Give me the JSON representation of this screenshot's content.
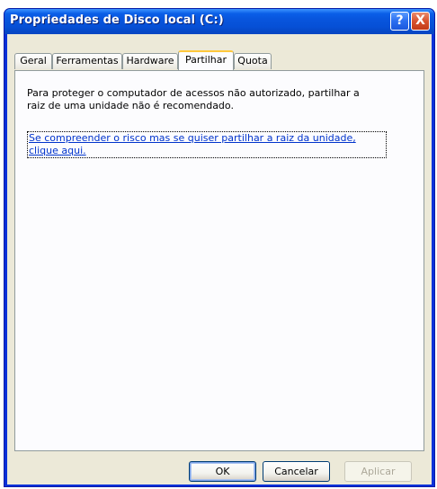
{
  "window": {
    "title": "Propriedades de Disco local (C:)",
    "help_glyph": "?",
    "close_glyph": "X"
  },
  "tabs": [
    {
      "label": "Geral",
      "active": false
    },
    {
      "label": "Ferramentas",
      "active": false
    },
    {
      "label": "Hardware",
      "active": false
    },
    {
      "label": "Partilhar",
      "active": true
    },
    {
      "label": "Quota",
      "active": false
    }
  ],
  "panel": {
    "message_line1": "Para proteger o computador de acessos não autorizado, partilhar a",
    "message_line2": "raiz de uma unidade não é recomendado.",
    "link_line1": "Se compreender o risco mas se quiser partilhar a raiz da unidade,",
    "link_line2": "clique aqui."
  },
  "buttons": {
    "ok": "OK",
    "cancel": "Cancelar",
    "apply": "Aplicar"
  },
  "colors": {
    "titlebar": "#0a5fe8",
    "dialog_face": "#ece9d8",
    "panel_bg": "#fcfcfe",
    "active_tab_accent": "#ffc83c",
    "link": "#0033cc",
    "close_button": "#d8532f"
  }
}
